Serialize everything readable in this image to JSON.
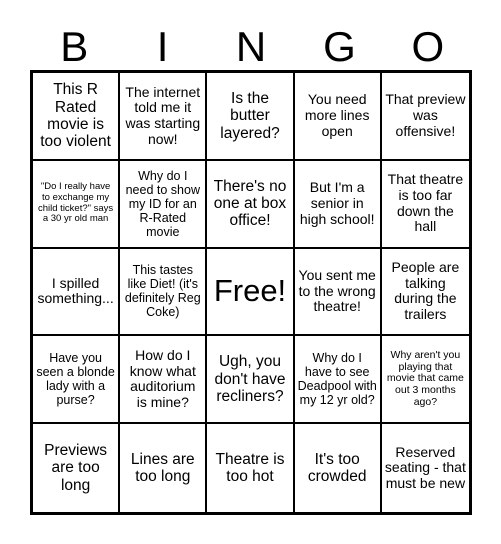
{
  "header": {
    "letters": [
      "B",
      "I",
      "N",
      "G",
      "O"
    ]
  },
  "grid": {
    "rows": 5,
    "columns": 5,
    "free_space_index": 12,
    "cells": [
      {
        "text": "This R Rated movie is too violent",
        "size": "sz-lg",
        "marked": false
      },
      {
        "text": "The internet told me it was starting now!",
        "size": "sz-md",
        "marked": false
      },
      {
        "text": "Is the butter layered?",
        "size": "sz-lg",
        "marked": false
      },
      {
        "text": "You need more lines open",
        "size": "sz-md",
        "marked": false
      },
      {
        "text": "That preview was offensive!",
        "size": "sz-md",
        "marked": false
      },
      {
        "text": "\"Do I really have to exchange my child ticket?\" says a 30 yr old man",
        "size": "sz-xxs",
        "marked": false
      },
      {
        "text": "Why do I need to show my ID for an R-Rated movie",
        "size": "sz-sm",
        "marked": false
      },
      {
        "text": "There's no one at box office!",
        "size": "sz-lg",
        "marked": false
      },
      {
        "text": "But I'm a senior in high school!",
        "size": "sz-md",
        "marked": false
      },
      {
        "text": "That theatre is too far down the hall",
        "size": "sz-md",
        "marked": false
      },
      {
        "text": "I spilled something...",
        "size": "sz-md",
        "marked": false
      },
      {
        "text": "This tastes like Diet! (it's definitely Reg Coke)",
        "size": "sz-sm",
        "marked": false
      },
      {
        "text": "Free!",
        "size": "sz-free",
        "marked": false
      },
      {
        "text": "You sent me to the wrong theatre!",
        "size": "sz-md",
        "marked": false
      },
      {
        "text": "People are talking during the trailers",
        "size": "sz-md",
        "marked": false
      },
      {
        "text": "Have you seen a blonde lady with a purse?",
        "size": "sz-sm",
        "marked": false
      },
      {
        "text": "How do I know what auditorium is mine?",
        "size": "sz-md",
        "marked": false
      },
      {
        "text": "Ugh, you don't have recliners?",
        "size": "sz-lg",
        "marked": false
      },
      {
        "text": "Why do I have to see Deadpool with my 12 yr old?",
        "size": "sz-sm",
        "marked": false
      },
      {
        "text": "Why aren't you playing that movie that came out 3 months ago?",
        "size": "sz-xs",
        "marked": false
      },
      {
        "text": "Previews are too long",
        "size": "sz-lg",
        "marked": false
      },
      {
        "text": "Lines are too long",
        "size": "sz-lg",
        "marked": false
      },
      {
        "text": "Theatre is too hot",
        "size": "sz-lg",
        "marked": false
      },
      {
        "text": "It's too crowded",
        "size": "sz-lg",
        "marked": false
      },
      {
        "text": "Reserved seating - that must be new",
        "size": "sz-md",
        "marked": false
      }
    ]
  },
  "colors": {
    "background": "#ffffff",
    "border": "#000000",
    "text": "#000000"
  }
}
